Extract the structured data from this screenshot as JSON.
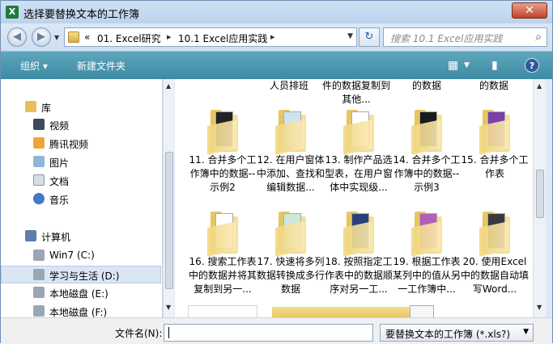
{
  "window": {
    "title": "选择要替换文本的工作簿",
    "app_icon": "excel-icon",
    "close_label": "✕"
  },
  "address": {
    "overflow": "«",
    "crumbs": [
      "01. Excel研究",
      "10.1 Excel应用实践"
    ],
    "search_placeholder": "搜索 10.1 Excel应用实践"
  },
  "toolbar": {
    "organize": "组织 ▾",
    "new_folder": "新建文件夹"
  },
  "nav": {
    "items": [
      {
        "label": "库",
        "icon": "library-icon"
      },
      {
        "label": "视频",
        "icon": "video-icon"
      },
      {
        "label": "腾讯视频",
        "icon": "tencent-video-icon"
      },
      {
        "label": "图片",
        "icon": "pictures-icon"
      },
      {
        "label": "文档",
        "icon": "documents-icon"
      },
      {
        "label": "音乐",
        "icon": "music-icon"
      },
      {
        "label": "计算机",
        "icon": "computer-icon"
      },
      {
        "label": "Win7 (C:)",
        "icon": "drive-icon"
      },
      {
        "label": "学习与生活 (D:)",
        "icon": "drive-icon"
      },
      {
        "label": "本地磁盘 (E:)",
        "icon": "drive-icon"
      },
      {
        "label": "本地磁盘 (F:)",
        "icon": "drive-icon"
      }
    ]
  },
  "files": {
    "row0": [
      "人员排班",
      "件的数据复制到其他...",
      "的数据",
      "的数据"
    ],
    "row1": [
      "11. 合并多个工作簿中的数据--示例2",
      "12. 在用户窗体中添加、查找和编辑数据...",
      "13. 制作产品选型表，在用户窗体中实现级...",
      "14. 合并多个工作簿中的数据--示例3",
      "15. 合并多个工作表"
    ],
    "row2": [
      "16. 搜索工作表中的数据并将其复制到另一...",
      "17. 快速将多列数据转换成多行数据",
      "18. 按照指定工作表中的数据顺序对另一工...",
      "19. 根据工作表某列中的值从另一工作簿中...",
      "20. 使用Excel中的数据自动填写Word..."
    ]
  },
  "footer": {
    "filename_label": "文件名(N):",
    "filename_value": "",
    "filter": "要替换文本的工作簿 (*.xls?)"
  }
}
